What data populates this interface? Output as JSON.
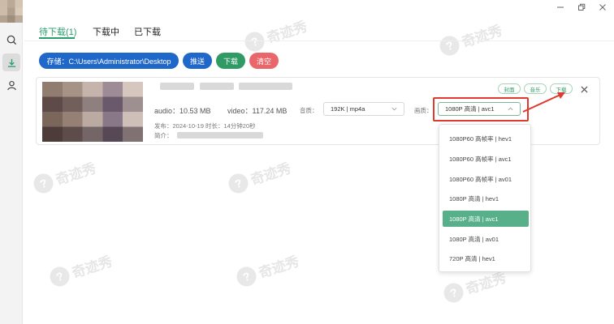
{
  "tabs": [
    {
      "label": "待下载(1)",
      "active": true
    },
    {
      "label": "下载中",
      "active": false
    },
    {
      "label": "已下载",
      "active": false
    }
  ],
  "toolbar": {
    "path_label": "存储：C:\\Users\\Administrator\\Desktop",
    "push_label": "推送",
    "download_label": "下载",
    "clear_label": "清空"
  },
  "item": {
    "audio_size": "audio：10.53 MB",
    "video_size": "video：117.24 MB",
    "published": "发布：2024-10-19 时长：14分钟20秒",
    "intro_label": "简介：",
    "audio_quality_label": "音质：",
    "audio_quality_value": "192K | mp4a",
    "video_quality_label": "画质：",
    "video_quality_value": "1080P 高清 | avc1",
    "cover_btn": "封面",
    "music_btn": "音乐",
    "download_btn": "下载"
  },
  "quality_options": [
    {
      "label": "1080P60 高帧率 | hev1",
      "selected": false
    },
    {
      "label": "1080P60 高帧率 | avc1",
      "selected": false
    },
    {
      "label": "1080P60 高帧率 | av01",
      "selected": false
    },
    {
      "label": "1080P 高清 | hev1",
      "selected": false
    },
    {
      "label": "1080P 高清 | avc1",
      "selected": true
    },
    {
      "label": "1080P 高清 | av01",
      "selected": false
    },
    {
      "label": "720P 高清 | hev1",
      "selected": false
    }
  ],
  "watermark_text": "奇迹秀",
  "colors": {
    "accent_green": "#2a9d6c",
    "primary_blue": "#1f67c9",
    "danger_red": "#e9676a",
    "highlight_red": "#e03a2e"
  },
  "icons": {
    "sidebar": [
      "search-icon",
      "download-icon",
      "user-icon"
    ],
    "window": [
      "minimize-icon",
      "restore-icon",
      "close-icon"
    ]
  }
}
